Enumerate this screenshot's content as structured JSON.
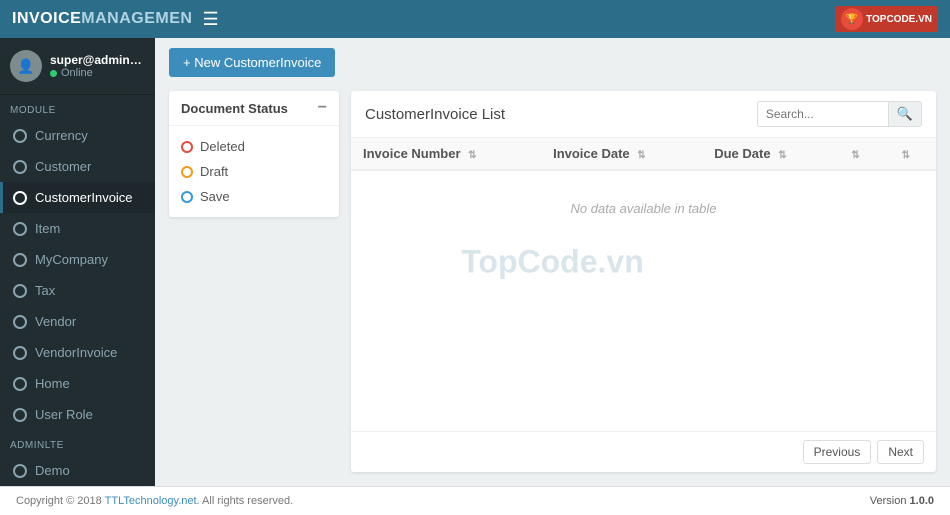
{
  "topnav": {
    "brand_inv": "INVOICE",
    "brand_mgmt": "MANAGEMEN",
    "hamburger": "☰",
    "logo_text": "TOPCODE.VN"
  },
  "sidebar": {
    "username": "super@admin.com",
    "status": "Online",
    "module_label": "MODULE",
    "adminlte_label": "ADMINLTE",
    "items": [
      {
        "label": "Currency",
        "id": "currency"
      },
      {
        "label": "Customer",
        "id": "customer"
      },
      {
        "label": "CustomerInvoice",
        "id": "customerinvoice"
      },
      {
        "label": "Item",
        "id": "item"
      },
      {
        "label": "MyCompany",
        "id": "mycompany"
      },
      {
        "label": "Tax",
        "id": "tax"
      },
      {
        "label": "Vendor",
        "id": "vendor"
      },
      {
        "label": "VendorInvoice",
        "id": "vendorinvoice"
      },
      {
        "label": "Home",
        "id": "home"
      },
      {
        "label": "User Role",
        "id": "userrole"
      }
    ],
    "adminlte_items": [
      {
        "label": "Demo",
        "id": "demo"
      }
    ]
  },
  "new_invoice_btn": "+ New CustomerInvoice",
  "filter": {
    "title": "Document Status",
    "options": [
      {
        "label": "Deleted",
        "type": "deleted"
      },
      {
        "label": "Draft",
        "type": "draft"
      },
      {
        "label": "Save",
        "type": "save"
      }
    ]
  },
  "invoice_list": {
    "title": "CustomerInvoice List",
    "search_placeholder": "Search...",
    "columns": [
      {
        "label": "Invoice Number",
        "sortable": true
      },
      {
        "label": "Invoice Date",
        "sortable": true
      },
      {
        "label": "Due Date",
        "sortable": true
      },
      {
        "label": "",
        "sortable": true
      },
      {
        "label": "",
        "sortable": true
      }
    ],
    "no_data": "No data available in table",
    "pagination": {
      "previous": "Previous",
      "next": "Next"
    }
  },
  "footer": {
    "copyright": "Copyright © 2018 ",
    "link_text": "TTLTechnology.net.",
    "rights": " All rights reserved.",
    "version_label": "Version ",
    "version_num": "1.0.0"
  },
  "watermark": "TopCode.vn"
}
